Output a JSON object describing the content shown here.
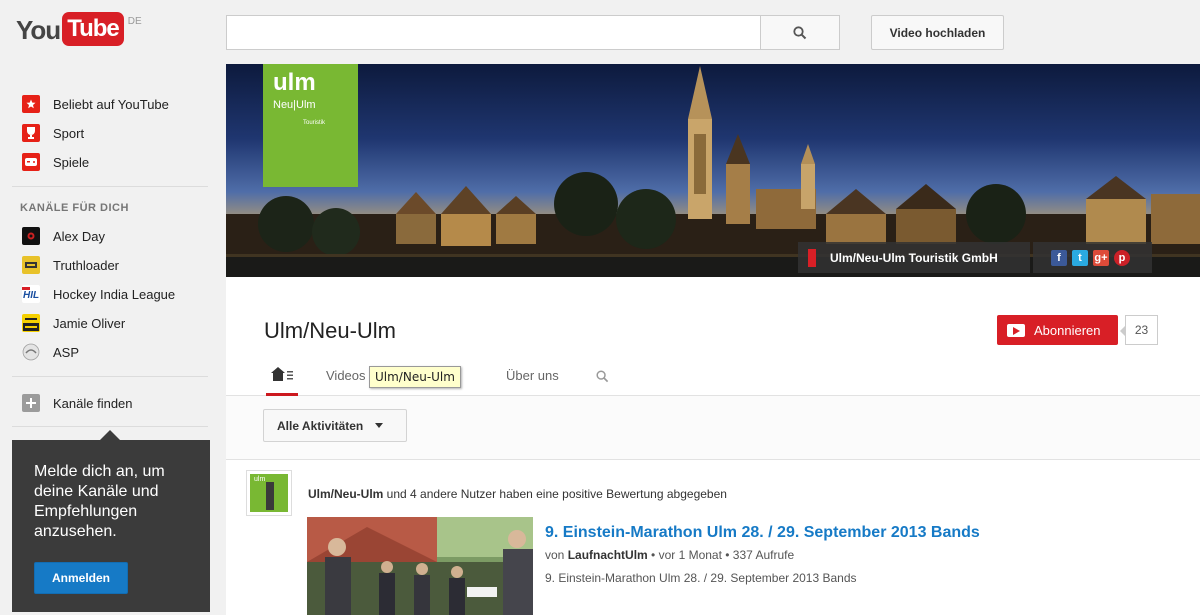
{
  "header": {
    "logo_you": "You",
    "logo_tube": "Tube",
    "logo_region": "DE",
    "search_placeholder": "",
    "upload_label": "Video hochladen"
  },
  "sidebar": {
    "top_items": [
      {
        "label": "Beliebt auf YouTube",
        "icon": "popular-icon"
      },
      {
        "label": "Sport",
        "icon": "sport-icon"
      },
      {
        "label": "Spiele",
        "icon": "games-icon"
      }
    ],
    "channels_heading": "KANÄLE FÜR DICH",
    "channels": [
      {
        "label": "Alex Day",
        "icon": "alex-day-avatar"
      },
      {
        "label": "Truthloader",
        "icon": "truthloader-avatar"
      },
      {
        "label": "Hockey India League",
        "icon": "hockey-india-league-avatar"
      },
      {
        "label": "Jamie Oliver",
        "icon": "jamie-oliver-avatar"
      },
      {
        "label": "ASP",
        "icon": "asp-avatar"
      }
    ],
    "find_channels": "Kanäle finden",
    "signin_text": "Melde dich an, um deine Kanäle und Empfehlungen anzusehen.",
    "signin_button": "Anmelden"
  },
  "channel": {
    "logo_line1": "ulm",
    "logo_line2": "Neu|Ulm",
    "logo_line3": "Touristik",
    "banner_link": "Ulm/Neu-Ulm Touristik GmbH",
    "social": [
      "f",
      "t",
      "g+",
      "p"
    ],
    "title": "Ulm/Neu-Ulm",
    "subscribe_label": "Abonnieren",
    "subscriber_count": "23",
    "tabs": {
      "videos": "Videos",
      "about": "Über uns"
    },
    "tooltip": "Ulm/Neu-Ulm",
    "filter_label": "Alle Aktivitäten"
  },
  "feed": {
    "avatar_text": "ulm",
    "actor": "Ulm/Neu-Ulm",
    "activity_rest": " und 4 andere Nutzer haben eine positive Bewertung abgegeben",
    "video_title": "9. Einstein-Marathon Ulm 28. / 29. September 2013 Bands",
    "meta_by": "von ",
    "meta_author": "LaufnachtUlm",
    "meta_rest": " • vor 1 Monat • 337 Aufrufe",
    "description": "9. Einstein-Marathon Ulm 28. / 29. September 2013 Bands"
  },
  "colors": {
    "brand_red": "#d81f26",
    "link_blue": "#167ac6",
    "ulm_green": "#79b833"
  }
}
